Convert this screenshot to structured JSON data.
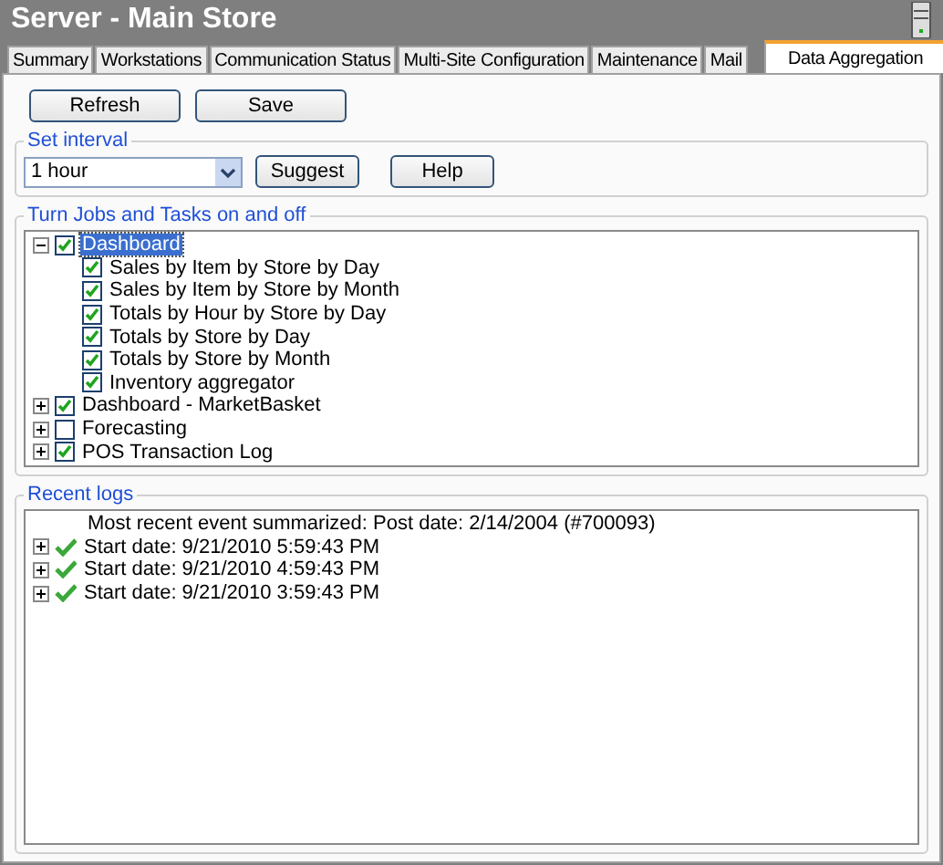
{
  "window": {
    "title": "Server - Main Store"
  },
  "tabs": [
    {
      "label": "Summary",
      "selected": false
    },
    {
      "label": "Workstations",
      "selected": false
    },
    {
      "label": "Communication Status",
      "selected": false
    },
    {
      "label": "Multi-Site Configuration",
      "selected": false
    },
    {
      "label": "Maintenance",
      "selected": false
    },
    {
      "label": "Mail",
      "selected": false
    },
    {
      "label": "Data Aggregation",
      "selected": true
    }
  ],
  "top_buttons": [
    "Refresh",
    "Save"
  ],
  "interval": {
    "legend": "Set interval",
    "value": "1 hour",
    "buttons": [
      "Suggest",
      "Help"
    ]
  },
  "jobs": {
    "legend": "Turn Jobs and Tasks on and off",
    "items": [
      {
        "label": "Dashboard",
        "checked": true,
        "expanded": true,
        "selected": true,
        "children": [
          {
            "label": "Sales by Item by Store by Day",
            "checked": true,
            "selected": false
          },
          {
            "label": "Sales by Item by Store by Month",
            "checked": true,
            "selected": false
          },
          {
            "label": "Totals by Hour by Store by Day",
            "checked": true,
            "selected": false
          },
          {
            "label": "Totals by Store by Day",
            "checked": true,
            "selected": false
          },
          {
            "label": "Totals by Store by Month",
            "checked": true,
            "selected": false
          },
          {
            "label": "Inventory aggregator",
            "checked": true,
            "selected": false
          }
        ]
      },
      {
        "label": "Dashboard - MarketBasket",
        "checked": true,
        "expanded": false,
        "selected": false
      },
      {
        "label": "Forecasting",
        "checked": false,
        "expanded": false,
        "selected": false
      },
      {
        "label": "POS Transaction Log",
        "checked": true,
        "expanded": false,
        "selected": false
      }
    ]
  },
  "logs": {
    "legend": "Recent logs",
    "items": [
      {
        "kind": "info",
        "text": "Most recent event summarized: Post date: 2/14/2004 (#700093)"
      },
      {
        "kind": "entry",
        "text": "Start date: 9/21/2010 5:59:43 PM",
        "expanded": false
      },
      {
        "kind": "entry",
        "text": "Start date: 9/21/2010 4:59:43 PM",
        "expanded": false
      },
      {
        "kind": "entry",
        "text": "Start date: 9/21/2010 3:59:43 PM",
        "expanded": false
      }
    ]
  }
}
